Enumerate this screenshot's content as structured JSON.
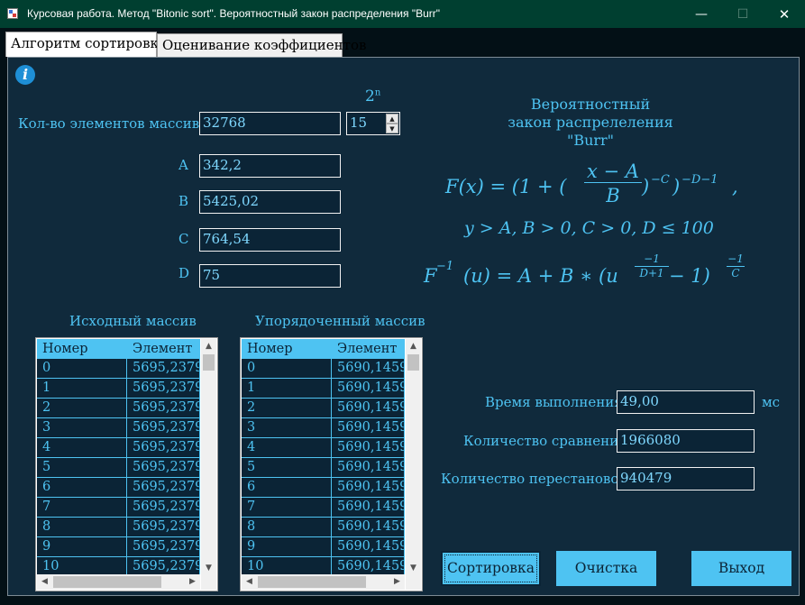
{
  "window": {
    "title": "Курсовая работа. Метод \"Bitonic sort\". Вероятностный закон распределения \"Burr\""
  },
  "tabs": [
    "Алгоритм сортировки",
    "Оценивание коэффициентов"
  ],
  "inputs": {
    "count_label": "Кол-во элементов массива",
    "count_value": "32768",
    "power_label": "2",
    "power_sup": "n",
    "power_value": "15",
    "a_label": "A",
    "a_value": "342,2",
    "b_label": "B",
    "b_value": "5425,02",
    "c_label": "C",
    "c_value": "764,54",
    "d_label": "D",
    "d_value": "75"
  },
  "law": {
    "heading_line1": "Вероятностный",
    "heading_line2": "закон распрелеления",
    "heading_line3": "\"Burr\""
  },
  "formulas": {
    "f_lhs": "F(x) = (1 + (",
    "f_num": "x − A",
    "f_den": "B",
    "f_tail": ")",
    "f_exp1": "−C",
    "f_tail2": ")",
    "f_exp2": "−D−1",
    "f_comma": ",",
    "conditions": "y > A, B > 0, C > 0, D ≤ 100",
    "inv_lhs": "F",
    "inv_sup": "−1",
    "inv_mid": "(u) = A + B ∗ (u",
    "inv_e_num": "−1",
    "inv_e_den": "D+1",
    "inv_tail": " − 1)",
    "inv_e2_num": "−1",
    "inv_e2_den": "C"
  },
  "source_table": {
    "caption": "Исходный массив",
    "headers": [
      "Номер",
      "Элемент"
    ],
    "rows": [
      [
        "0",
        "5695,2379..."
      ],
      [
        "1",
        "5695,2379..."
      ],
      [
        "2",
        "5695,2379..."
      ],
      [
        "3",
        "5695,2379..."
      ],
      [
        "4",
        "5695,2379..."
      ],
      [
        "5",
        "5695,2379..."
      ],
      [
        "6",
        "5695,2379..."
      ],
      [
        "7",
        "5695,2379..."
      ],
      [
        "8",
        "5695,2379..."
      ],
      [
        "9",
        "5695,2379..."
      ],
      [
        "10",
        "5695,2379..."
      ]
    ]
  },
  "sorted_table": {
    "caption": "Упорядоченный массив",
    "headers": [
      "Номер",
      "Элемент"
    ],
    "rows": [
      [
        "0",
        "5690,1459..."
      ],
      [
        "1",
        "5690,1459..."
      ],
      [
        "2",
        "5690,1459..."
      ],
      [
        "3",
        "5690,1459..."
      ],
      [
        "4",
        "5690,1459..."
      ],
      [
        "5",
        "5690,1459..."
      ],
      [
        "6",
        "5690,1459..."
      ],
      [
        "7",
        "5690,1459..."
      ],
      [
        "8",
        "5690,1459..."
      ],
      [
        "9",
        "5690,1459..."
      ],
      [
        "10",
        "5690,1459..."
      ]
    ]
  },
  "stats": {
    "time_label": "Время выполнения",
    "time_value": "49,00",
    "time_unit": "мс",
    "cmp_label": "Количество сравнений",
    "cmp_value": "1966080",
    "swap_label": "Количество перестановок",
    "swap_value": "940479"
  },
  "buttons": {
    "sort": "Сортировка",
    "clear": "Очистка",
    "exit": "Выход"
  },
  "colors": {
    "accent": "#4ec3f2",
    "panel": "#102a3c",
    "titlebar": "#003F30"
  }
}
